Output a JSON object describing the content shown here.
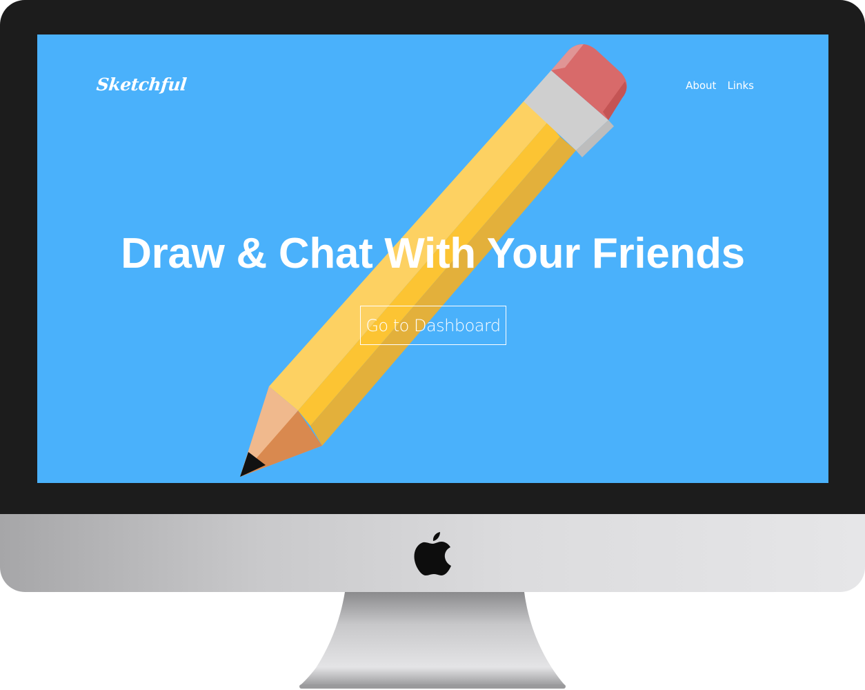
{
  "site": {
    "brand": "Sketchful",
    "nav": [
      {
        "label": "About"
      },
      {
        "label": "Links"
      }
    ]
  },
  "hero": {
    "title": "Draw & Chat With Your Friends",
    "cta_label": "Go to Dashboard"
  },
  "colors": {
    "screen_background": "#4ab1fb",
    "bezel": "#1c1c1c",
    "pencil_body": "#fcc433",
    "eraser": "#d86a6a",
    "ferrule": "#cfcfcf"
  },
  "icons": {
    "hero_illustration": "pencil-illustration",
    "monitor_logo": "apple-logo-icon"
  }
}
